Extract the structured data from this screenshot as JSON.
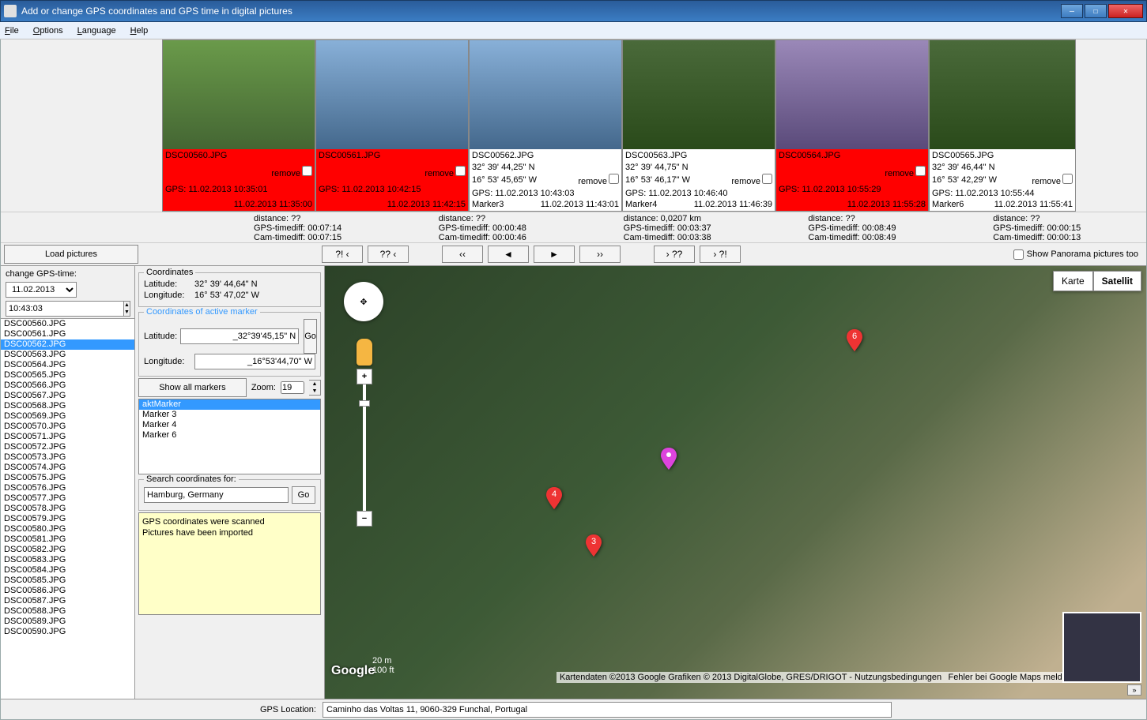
{
  "window": {
    "title": "Add or change GPS coordinates and GPS time in digital pictures"
  },
  "menu": {
    "file": "File",
    "options": "Options",
    "language": "Language",
    "help": "Help"
  },
  "thumbs": [
    {
      "file": "DSC00560.JPG",
      "remove": "remove",
      "gps": "GPS: 11.02.2013 10:35:01",
      "cam": "11.02.2013 11:35:00",
      "lat": "",
      "lon": "",
      "marker": "",
      "red": true,
      "imgcls": "garden"
    },
    {
      "file": "DSC00561.JPG",
      "remove": "remove",
      "gps": "GPS: 11.02.2013 10:42:15",
      "cam": "11.02.2013 11:42:15",
      "lat": "",
      "lon": "",
      "marker": "",
      "red": true,
      "imgcls": "sea"
    },
    {
      "file": "DSC00562.JPG",
      "remove": "remove",
      "gps": "GPS: 11.02.2013 10:43:03",
      "cam": "11.02.2013 11:43:01",
      "lat": "32° 39' 44,25\" N",
      "lon": "16° 53' 45,65\" W",
      "marker": "Marker3",
      "red": false,
      "imgcls": "sea"
    },
    {
      "file": "DSC00563.JPG",
      "remove": "remove",
      "gps": "GPS: 11.02.2013 10:46:40",
      "cam": "11.02.2013 11:46:39",
      "lat": "32° 39' 44,75\" N",
      "lon": "16° 53' 46,17\" W",
      "marker": "Marker4",
      "red": false,
      "imgcls": "plant"
    },
    {
      "file": "DSC00564.JPG",
      "remove": "remove",
      "gps": "GPS: 11.02.2013 10:55:29",
      "cam": "11.02.2013 11:55:28",
      "lat": "",
      "lon": "",
      "marker": "",
      "red": true,
      "imgcls": "flower"
    },
    {
      "file": "DSC00565.JPG",
      "remove": "remove",
      "gps": "GPS: 11.02.2013 10:55:44",
      "cam": "11.02.2013 11:55:41",
      "lat": "32° 39' 46,44\" N",
      "lon": "16° 53' 42,29\" W",
      "marker": "Marker6",
      "red": false,
      "imgcls": "plant"
    }
  ],
  "diststats": [
    {
      "dist": "distance: ??",
      "gpsd": "GPS-timediff: 00:07:14",
      "camd": "Cam-timediff: 00:07:15"
    },
    {
      "dist": "distance: ??",
      "gpsd": "GPS-timediff: 00:00:48",
      "camd": "Cam-timediff: 00:00:46"
    },
    {
      "dist": "distance: 0,0207 km",
      "gpsd": "GPS-timediff: 00:03:37",
      "camd": "Cam-timediff: 00:03:38"
    },
    {
      "dist": "distance: ??",
      "gpsd": "GPS-timediff: 00:08:49",
      "camd": "Cam-timediff: 00:08:49"
    },
    {
      "dist": "distance: ??",
      "gpsd": "GPS-timediff: 00:00:15",
      "camd": "Cam-timediff: 00:00:13"
    }
  ],
  "nav": {
    "load": "Load pictures",
    "b1": "?! ‹",
    "b2": "?? ‹",
    "b3": "‹‹",
    "b4": "◄",
    "b5": "►",
    "b6": "››",
    "b7": "› ??",
    "b8": "› ?!",
    "pano": "Show Panorama pictures too"
  },
  "left": {
    "change_label": "change GPS-time:",
    "date": "11.02.2013",
    "time": "10:43:03",
    "files": [
      "DSC00560.JPG",
      "DSC00561.JPG",
      "DSC00562.JPG",
      "DSC00563.JPG",
      "DSC00564.JPG",
      "DSC00565.JPG",
      "DSC00566.JPG",
      "DSC00567.JPG",
      "DSC00568.JPG",
      "DSC00569.JPG",
      "DSC00570.JPG",
      "DSC00571.JPG",
      "DSC00572.JPG",
      "DSC00573.JPG",
      "DSC00574.JPG",
      "DSC00575.JPG",
      "DSC00576.JPG",
      "DSC00577.JPG",
      "DSC00578.JPG",
      "DSC00579.JPG",
      "DSC00580.JPG",
      "DSC00581.JPG",
      "DSC00582.JPG",
      "DSC00583.JPG",
      "DSC00584.JPG",
      "DSC00585.JPG",
      "DSC00586.JPG",
      "DSC00587.JPG",
      "DSC00588.JPG",
      "DSC00589.JPG",
      "DSC00590.JPG"
    ],
    "selected": 2
  },
  "mid": {
    "coords_title": "Coordinates",
    "lat_label": "Latitude:",
    "lat_val": "32° 39' 44,64\" N",
    "lon_label": "Longitude:",
    "lon_val": "16° 53' 47,02\" W",
    "active_title": "Coordinates of active marker",
    "alat": "_32°39'45,15\" N",
    "alon": "_16°53'44,70\" W",
    "go": "Go",
    "show_all": "Show all markers",
    "zoom_label": "Zoom:",
    "zoom_val": "19",
    "markers": [
      "aktMarker",
      "Marker 3",
      "Marker 4",
      "Marker 6"
    ],
    "marker_sel": 0,
    "search_label": "Search coordinates for:",
    "search_val": "Hamburg, Germany",
    "log1": "GPS coordinates were scanned",
    "log2": "Pictures have been imported"
  },
  "map": {
    "karte": "Karte",
    "sat": "Satellit",
    "scale1": "20 m",
    "scale2": "100 ft",
    "attr": "Kartendaten ©2013 Google Grafiken © 2013 DigitalGlobe, GRES/DRIGOT - Nutzungsbedingungen",
    "err": "Fehler bei Google Maps melden",
    "logo": "Google"
  },
  "footer": {
    "label": "GPS Location:",
    "val": "Caminho das Voltas 11, 9060-329 Funchal, Portugal"
  }
}
